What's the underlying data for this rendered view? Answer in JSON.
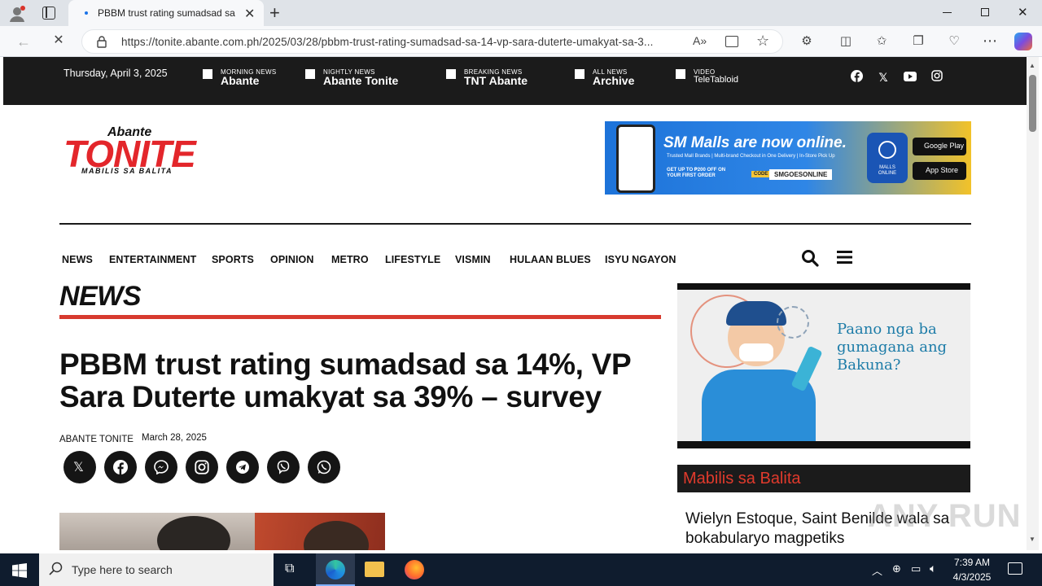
{
  "browser": {
    "tab_title": "PBBM trust rating sumadsad sa 1",
    "url": "https://tonite.abante.com.ph/2025/03/28/pbbm-trust-rating-sumadsad-sa-14-vp-sara-duterte-umakyat-sa-3..."
  },
  "topbar": {
    "date": "Thursday, April 3, 2025",
    "items": [
      {
        "small": "MORNING NEWS",
        "big": "Abante"
      },
      {
        "small": "NIGHTLY NEWS",
        "big": "Abante Tonite"
      },
      {
        "small": "BREAKING NEWS",
        "big": "TNT Abante"
      },
      {
        "small": "ALL NEWS",
        "big": "Archive"
      },
      {
        "small": "VIDEO",
        "big": "TeleTabloid"
      }
    ]
  },
  "logo": {
    "top": "Abante",
    "main": "TONITE",
    "tagline": "MABILIS SA BALITA"
  },
  "ad_banner": {
    "headline": "SM Malls are now online.",
    "sub": "Trusted Mall Brands | Multi-brand Checkout in One Delivery | In-Store Pick Up",
    "offer": "GET UP TO ₱200 OFF ON YOUR FIRST ORDER",
    "code_label": "CODE",
    "code": "SMGOESONLINE",
    "badge": "MALLS ONLINE",
    "google_play": "Google Play",
    "app_store": "App Store"
  },
  "nav": {
    "items": [
      "NEWS",
      "ENTERTAINMENT",
      "SPORTS",
      "OPINION",
      "METRO",
      "LIFESTYLE",
      "VISMIN",
      "HULAAN BLUES",
      "ISYU NGAYON"
    ]
  },
  "article": {
    "section": "NEWS",
    "headline": "PBBM trust rating sumadsad sa 14%, VP Sara Duterte umakyat sa 39% – survey",
    "author": "ABANTE TONITE",
    "date": "March 28, 2025"
  },
  "sidebar": {
    "ad_text": "Paano nga ba gumagana ang Bakuna?",
    "section": "Mabilis sa Balita",
    "story": "Wielyn Estoque, Saint Benilde wala sa bokabularyo magpetiks"
  },
  "watermark": "ANY RUN",
  "taskbar": {
    "search_placeholder": "Type here to search",
    "time": "7:39 AM",
    "date": "4/3/2025"
  },
  "colors": {
    "accent_red": "#d73a2e",
    "topbar": "#1b1b1b",
    "taskbar": "#0f1c2e"
  }
}
